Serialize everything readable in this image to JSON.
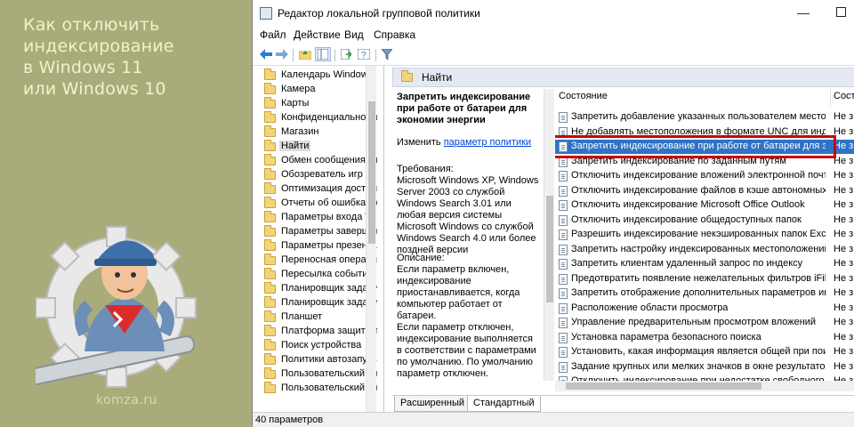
{
  "banner": {
    "title": "Как отключить\nиндексирование\nв Windows 11\nили Windows 10",
    "site": "komza.ru"
  },
  "window": {
    "title": "Редактор локальной групповой политики",
    "min_glyph": "—"
  },
  "menu": [
    "Файл",
    "Действие",
    "Вид",
    "Справка"
  ],
  "toolbar_icons": [
    "back-arrow-icon",
    "forward-arrow-icon",
    "folder-up-icon",
    "show-hide-tree-icon",
    "export-icon",
    "help-icon",
    "filter-icon"
  ],
  "tree": {
    "items": [
      "Календарь Windows",
      "Камера",
      "Карты",
      "Конфиденциальность",
      "Магазин",
      "Найти",
      "Обмен сообщениями",
      "Обозреватель игр",
      "Оптимизация доставки",
      "Отчеты об ошибках Windows",
      "Параметры входа Windows",
      "Параметры завершения",
      "Параметры презентации",
      "Переносная операционная",
      "Пересылка событий",
      "Планировщик заданий",
      "Планировщик заданий",
      "Планшет",
      "Платформа защиты программ",
      "Поиск устройства",
      "Политики автозапуска",
      "Пользовательский инт",
      "Пользовательский инт"
    ],
    "selected_index": 5
  },
  "header_band": {
    "label": "Найти"
  },
  "description": {
    "title": "Запретить индексирование при работе от батареи для экономии энергии",
    "change_prefix": "Изменить ",
    "change_link": "параметр политики",
    "requirements": "Требования:\nMicrosoft Windows XP, Windows Server 2003 со службой Windows Search 3.01 или любая версия системы Microsoft Windows со службой Windows Search 4.0 или более поздней версии",
    "body": "Описание:\nЕсли параметр включен, индексирование приостанавливается, когда компьютер работает от батареи.\nЕсли параметр отключен, индексирование выполняется в соответствии с параметрами по умолчанию. По умолчанию параметр отключен."
  },
  "list": {
    "col_state": "Состояние",
    "col_status": "Сост",
    "rows": [
      {
        "name": "Запретить добавление указанных пользователем местоп...",
        "state": "Не з"
      },
      {
        "name": "Не добавлять местоположения в формате UNC для инде...",
        "state": "Не з"
      },
      {
        "name": "Запретить индексирование при работе от батареи для эк...",
        "state": "Не з"
      },
      {
        "name": "Запретить индексирование по заданным путям",
        "state": "Не з"
      },
      {
        "name": "Отключить индексирование вложений электронной почт...",
        "state": "Не з"
      },
      {
        "name": "Отключить индексирование файлов в кэше автономных ...",
        "state": "Не з"
      },
      {
        "name": "Отключить индексирование Microsoft Office Outlook",
        "state": "Не з"
      },
      {
        "name": "Отключить индексирование общедоступных папок",
        "state": "Не з"
      },
      {
        "name": "Разрешить индексирование некэшированных папок Exch...",
        "state": "Не з"
      },
      {
        "name": "Запретить настройку индексированных местоположений",
        "state": "Не з"
      },
      {
        "name": "Запретить клиентам удаленный запрос по индексу",
        "state": "Не з"
      },
      {
        "name": "Предотвратить появление нежелательных фильтров iFilt...",
        "state": "Не з"
      },
      {
        "name": "Запретить отображение дополнительных параметров ин...",
        "state": "Не з"
      },
      {
        "name": "Расположение области просмотра",
        "state": "Не з"
      },
      {
        "name": "Управление предварительным просмотром вложений",
        "state": "Не з"
      },
      {
        "name": "Установка параметра безопасного поиска",
        "state": "Не з"
      },
      {
        "name": "Установить, какая информация является общей при поис...",
        "state": "Не з"
      },
      {
        "name": "Задание крупных или мелких значков в окне результатов...",
        "state": "Не з"
      },
      {
        "name": "Отключить индексирование при недостатке свободного ...",
        "state": "Не з"
      }
    ],
    "selected_index": 2,
    "highlight_color": "#cc0000",
    "selection_color": "#2f73c6"
  },
  "tabs": [
    "Расширенный",
    "Стандартный"
  ],
  "status": "40 параметров"
}
